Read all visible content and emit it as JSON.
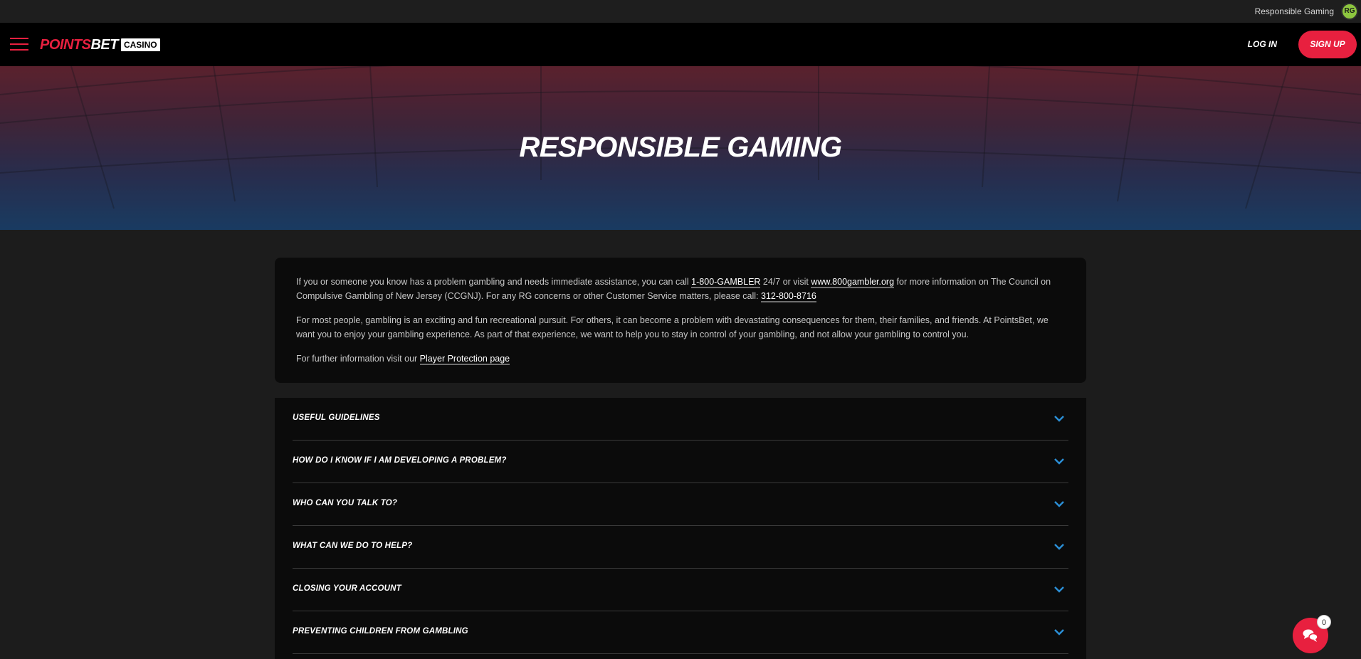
{
  "topbar": {
    "rg_link": "Responsible Gaming",
    "rg_badge": "RG"
  },
  "header": {
    "logo_points": "POINTS",
    "logo_bet": "BET",
    "logo_casino": "CASINO",
    "login_label": "LOG IN",
    "signup_label": "SIGN UP"
  },
  "hero": {
    "title": "RESPONSIBLE GAMING"
  },
  "intro": {
    "p1_a": "If you or someone you know has a problem gambling and needs immediate assistance, you can call ",
    "p1_link1": "1-800-GAMBLER",
    "p1_b": " 24/7 or visit ",
    "p1_link2": "www.800gambler.org",
    "p1_c": " for more information on The Council on Compulsive Gambling of New Jersey (CCGNJ). For any RG concerns or other Customer Service matters, please call: ",
    "p1_link3": "312-800-8716",
    "p2": "For most people, gambling is an exciting and fun recreational pursuit. For others, it can become a problem with devastating consequences for them, their families, and friends. At PointsBet, we want you to enjoy your gambling experience. As part of that experience, we want to help you to stay in control of your gambling, and not allow your gambling to control you.",
    "p3_a": "For further information visit our ",
    "p3_link": "Player Protection page"
  },
  "accordion": {
    "items": [
      {
        "label": "USEFUL GUIDELINES"
      },
      {
        "label": "HOW DO I KNOW IF I AM DEVELOPING A PROBLEM?"
      },
      {
        "label": "WHO CAN YOU TALK TO?"
      },
      {
        "label": "WHAT CAN WE DO TO HELP?"
      },
      {
        "label": "CLOSING YOUR ACCOUNT"
      },
      {
        "label": "PREVENTING CHILDREN FROM GAMBLING"
      }
    ]
  },
  "chat": {
    "count": "0"
  },
  "colors": {
    "brand_red": "#e8203f",
    "chevron_blue": "#2b8fd6",
    "card_bg": "#0b0b0b",
    "page_bg": "#1c1c1c"
  },
  "icons": {
    "menu": "hamburger-icon",
    "accordion": "chevron-down-icon",
    "chat": "chat-bubbles-icon"
  }
}
